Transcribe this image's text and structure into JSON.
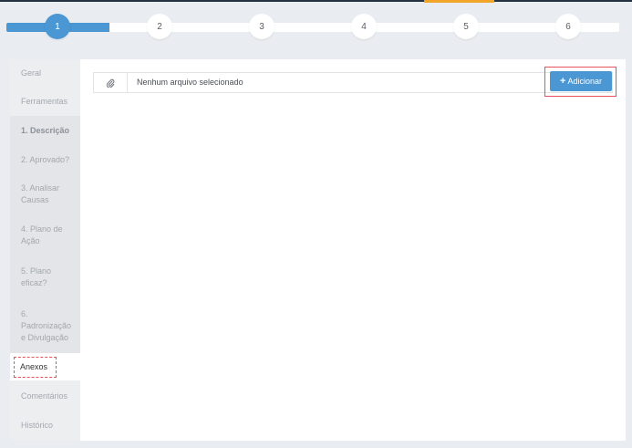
{
  "stepper": {
    "steps": [
      "1",
      "2",
      "3",
      "4",
      "5",
      "6"
    ],
    "active_step": "1"
  },
  "sidebar": {
    "items": [
      {
        "label": "Geral"
      },
      {
        "label": "Ferramentas"
      },
      {
        "label": "1. Descrição"
      },
      {
        "label": "2. Aprovado?"
      },
      {
        "label": "3. Analisar Causas"
      },
      {
        "label": "4. Plano de Ação"
      },
      {
        "label": "5. Plano eficaz?"
      },
      {
        "label": "6. Padronização e Divulgação"
      },
      {
        "label": "Anexos"
      },
      {
        "label": "Comentários"
      },
      {
        "label": "Histórico"
      }
    ],
    "selected": "Anexos"
  },
  "file_input": {
    "icon": "paperclip-icon",
    "placeholder_text": "Nenhum arquivo selecionado"
  },
  "add_button": {
    "icon": "plus",
    "label": "Adicionar"
  },
  "colors": {
    "accent": "#4a97d4",
    "highlight": "#e5535c",
    "top_accent": "#f3a52a"
  }
}
